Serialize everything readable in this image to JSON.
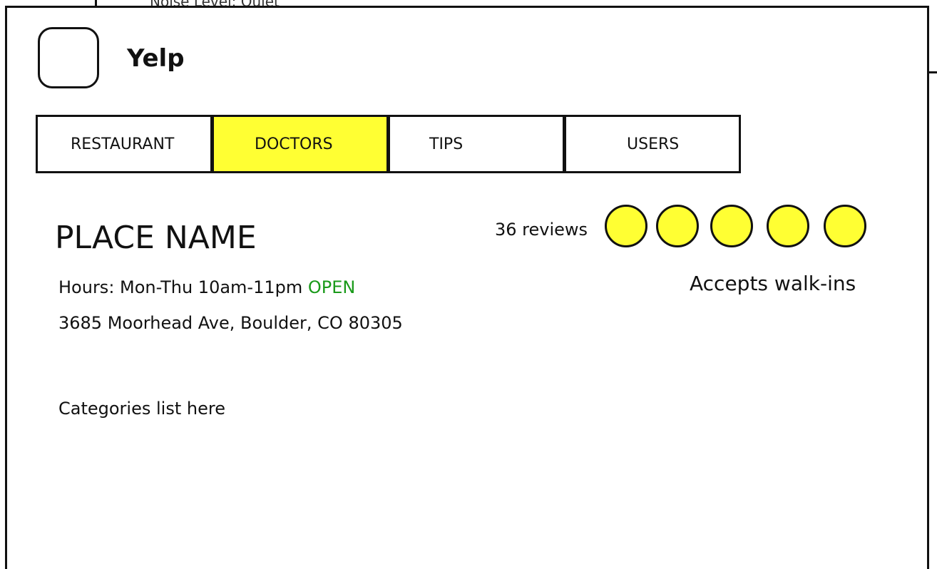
{
  "background_text": "Noise Level: Quiet",
  "header": {
    "title": "Yelp"
  },
  "tabs": [
    {
      "label": "RESTAURANT",
      "active": false
    },
    {
      "label": "DOCTORS",
      "active": true
    },
    {
      "label": "TIPS",
      "active": false
    },
    {
      "label": "USERS",
      "active": false
    }
  ],
  "place": {
    "name": "PLACE NAME",
    "hours_label": "Hours: Mon-Thu 10am-11pm",
    "status": "OPEN",
    "address": "3685 Moorhead Ave, Boulder, CO 80305",
    "categories": "Categories list here",
    "reviews": "36 reviews",
    "rating": 5,
    "walk_ins": "Accepts walk-ins"
  },
  "colors": {
    "accent": "#ffff33",
    "open": "#1a9a1a",
    "border": "#111111"
  }
}
